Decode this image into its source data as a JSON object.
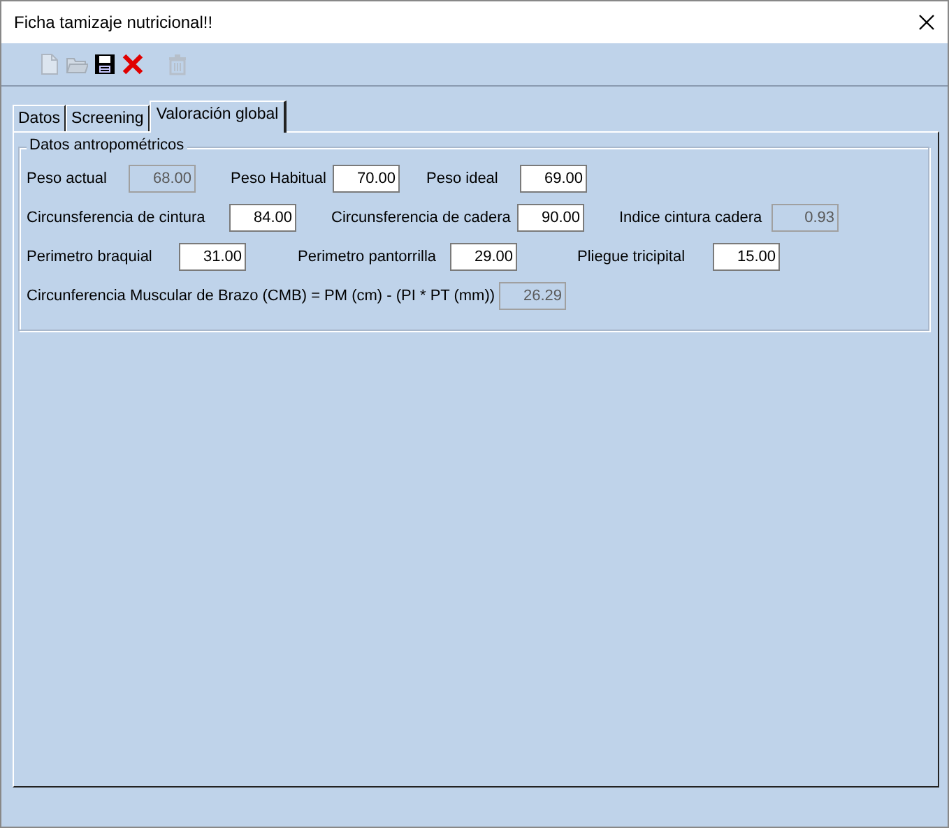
{
  "window": {
    "title": "Ficha tamizaje nutricional!!"
  },
  "toolbar": [
    {
      "kind": "new",
      "disabled": true
    },
    {
      "kind": "open",
      "disabled": true
    },
    {
      "kind": "save",
      "disabled": false
    },
    {
      "kind": "delete",
      "disabled": false
    },
    {
      "kind": "trash",
      "disabled": true
    }
  ],
  "tabs": [
    {
      "label": "Datos",
      "selected": false
    },
    {
      "label": "Screening",
      "selected": false
    },
    {
      "label": "Valoración global",
      "selected": true
    }
  ],
  "group": {
    "title": "Datos antropométricos",
    "rows": [
      [
        {
          "label": "Peso actual",
          "value": "68.00",
          "disabled": true
        },
        {
          "label": "Peso Habitual",
          "value": "70.00",
          "disabled": false
        },
        {
          "label": "Peso ideal",
          "value": "69.00",
          "disabled": false
        }
      ],
      [
        {
          "label": "Circunsferencia de cintura",
          "value": "84.00",
          "disabled": false
        },
        {
          "label": "Circunsferencia de cadera",
          "value": "90.00",
          "disabled": false
        },
        {
          "label": "Indice cintura cadera",
          "value": "0.93",
          "disabled": true
        }
      ],
      [
        {
          "label": "Perimetro braquial",
          "value": "31.00",
          "disabled": false
        },
        {
          "label": "Perimetro pantorrilla",
          "value": "29.00",
          "disabled": false
        },
        {
          "label": "Pliegue tricipital",
          "value": "15.00",
          "disabled": false
        }
      ],
      [
        {
          "label": "Circunferencia Muscular de Brazo (CMB) = PM (cm) - (PI * PT (mm))",
          "value": "26.29",
          "disabled": true
        }
      ]
    ]
  }
}
